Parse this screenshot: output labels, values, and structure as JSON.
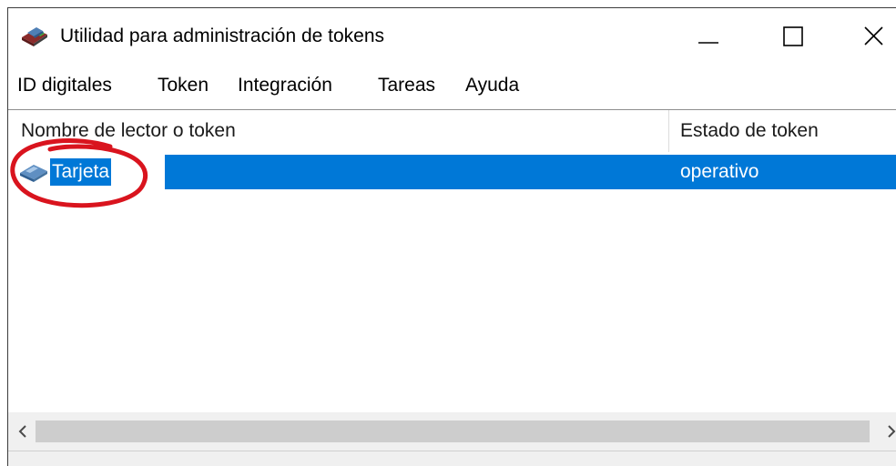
{
  "window": {
    "title": "Utilidad para administración de tokens",
    "app_icon": "smart-card-reader-icon",
    "controls": {
      "minimize_icon": "minimize-icon",
      "maximize_icon": "maximize-icon",
      "close_icon": "close-icon"
    }
  },
  "menubar": {
    "items": [
      {
        "label": "ID digitales"
      },
      {
        "label": "Token"
      },
      {
        "label": "Integración"
      },
      {
        "label": "Tareas"
      },
      {
        "label": "Ayuda"
      }
    ]
  },
  "list": {
    "columns": [
      {
        "label": "Nombre de lector o token"
      },
      {
        "label": "Estado de token"
      }
    ],
    "rows": [
      {
        "name": "Tarjeta",
        "state": "operativo",
        "icon": "smart-card-icon",
        "selected": true
      }
    ],
    "annotation": {
      "shape": "red-circle",
      "color": "#d9141e"
    },
    "selection_color": "#0078d7"
  },
  "scrollbar": {
    "left_icon": "chevron-left-icon",
    "right_icon": "chevron-right-icon"
  }
}
